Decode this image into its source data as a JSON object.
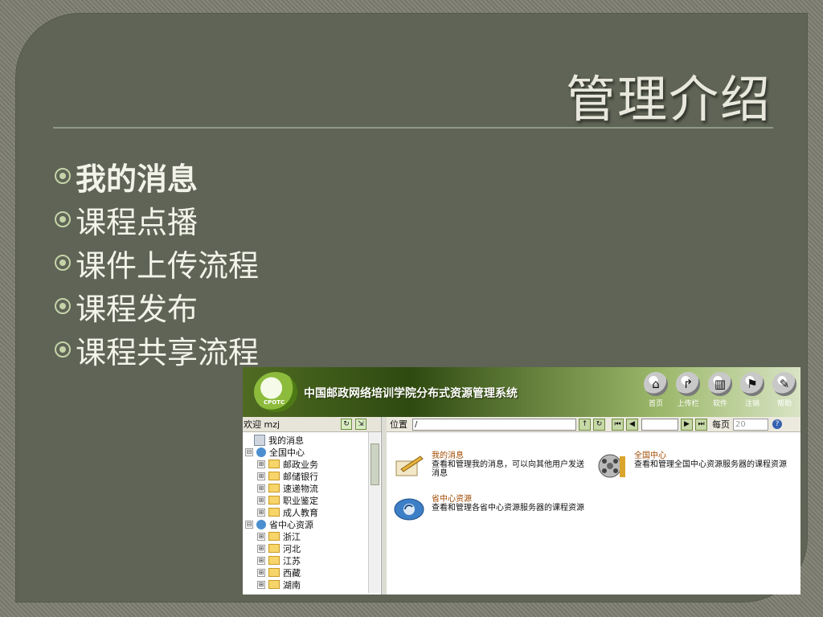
{
  "slide": {
    "title": "管理介绍",
    "bullets": [
      {
        "label": "我的消息",
        "active": true
      },
      {
        "label": "课程点播",
        "active": false
      },
      {
        "label": "课件上传流程",
        "active": false
      },
      {
        "label": "课程发布",
        "active": false
      },
      {
        "label": "课程共享流程",
        "active": false
      }
    ]
  },
  "app": {
    "logo_text": "CPOTC",
    "system_title": "中国邮政网络培训学院分布式资源管理系统",
    "nav": [
      {
        "label": "首页",
        "icon": "home-icon"
      },
      {
        "label": "上传栏",
        "icon": "upload-icon"
      },
      {
        "label": "软件",
        "icon": "software-icon"
      },
      {
        "label": "注销",
        "icon": "logout-icon"
      },
      {
        "label": "帮助",
        "icon": "help-icon"
      }
    ],
    "welcome": "欢迎 mzj",
    "location_label": "位置",
    "location_value": "/",
    "per_page_label": "每页",
    "per_page_value": "20",
    "tree": [
      {
        "label": "我的消息",
        "level": 0,
        "kind": "message"
      },
      {
        "label": "全国中心",
        "level": 0,
        "kind": "globe",
        "expander": "⊟"
      },
      {
        "label": "邮政业务",
        "level": 1,
        "kind": "folder",
        "expander": "⊞"
      },
      {
        "label": "邮储银行",
        "level": 1,
        "kind": "folder",
        "expander": "⊞"
      },
      {
        "label": "速递物流",
        "level": 1,
        "kind": "folder",
        "expander": "⊞"
      },
      {
        "label": "职业鉴定",
        "level": 1,
        "kind": "folder",
        "expander": "⊞"
      },
      {
        "label": "成人教育",
        "level": 1,
        "kind": "folder",
        "expander": "⊞"
      },
      {
        "label": "省中心资源",
        "level": 0,
        "kind": "globe",
        "expander": "⊟"
      },
      {
        "label": "浙江",
        "level": 1,
        "kind": "folder",
        "expander": "⊞"
      },
      {
        "label": "河北",
        "level": 1,
        "kind": "folder",
        "expander": "⊞"
      },
      {
        "label": "江苏",
        "level": 1,
        "kind": "folder",
        "expander": "⊞"
      },
      {
        "label": "西藏",
        "level": 1,
        "kind": "folder",
        "expander": "⊞"
      },
      {
        "label": "湖南",
        "level": 1,
        "kind": "folder",
        "expander": "⊞"
      }
    ],
    "cards": [
      {
        "title": "我的消息",
        "desc1": "查看和管理我的消息，可以向其他用户发送",
        "desc2": "消息",
        "icon": "edit-message-icon"
      },
      {
        "title": "全国中心",
        "desc1": "查看和管理全国中心资源服务器的课程资源",
        "desc2": "",
        "icon": "film-reel-icon"
      },
      {
        "title": "省中心资源",
        "desc1": "查看和管理各省中心资源服务器的课程资源",
        "desc2": "",
        "icon": "refresh-disc-icon"
      }
    ]
  }
}
